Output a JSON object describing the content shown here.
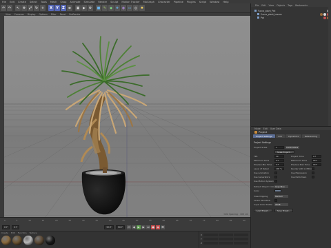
{
  "menubar": [
    "File",
    "Edit",
    "Create",
    "Select",
    "Tools",
    "Mesh",
    "Snap",
    "Animate",
    "Simulate",
    "Render",
    "Sculpt",
    "Motion Tracker",
    "MoGraph",
    "Character",
    "Pipeline",
    "Plugins",
    "Script",
    "Window",
    "Help"
  ],
  "toolbar": {
    "x": "X",
    "y": "Y",
    "z": "Z"
  },
  "viewport": {
    "menu": [
      "View",
      "Cameras",
      "Display",
      "Options",
      "Filter",
      "Panel",
      "ProRender"
    ],
    "grid_spacing": "Grid Spacing : 100 cm"
  },
  "timeline": {
    "ticks": [
      "0",
      "5",
      "10",
      "15",
      "20",
      "25",
      "30",
      "35",
      "40",
      "45",
      "50",
      "55",
      "60",
      "65",
      "70",
      "75",
      "80",
      "85",
      "90"
    ],
    "current_frame": "0 F",
    "start_frame": "0 F",
    "end_frame": "90 F",
    "end_frame_right": "90 F"
  },
  "materials": {
    "menu": [
      "Create",
      "Edit",
      "Function",
      "Texture"
    ],
    "swatch_colors": [
      "#8a6a3e",
      "#6b5433",
      "#b9b9b9",
      "#5c4a36",
      "#1a1a1a"
    ]
  },
  "coordinates": {
    "labels": [
      "X",
      "Y",
      "Z"
    ]
  },
  "object_manager": {
    "menu": [
      "File",
      "Edit",
      "View",
      "Objects",
      "Tags",
      "Bookmarks"
    ],
    "objects": [
      {
        "name": "Yucca_plant_Pot",
        "indent": 0,
        "tags": [
          "#8c8c8c"
        ]
      },
      {
        "name": "Yucca_plant_leaves",
        "indent": 1,
        "tags": [
          "#9a6a3a",
          "#d9d9d9",
          "#c05050"
        ]
      },
      {
        "name": "Pot",
        "indent": 1,
        "tags": [
          "#c05050",
          "#9a6a3a"
        ]
      }
    ]
  },
  "attributes": {
    "menu": [
      "Mode",
      "Edit",
      "User Data"
    ],
    "title": "Project",
    "tabs": [
      {
        "label": "Project Settings",
        "active": true
      },
      {
        "label": "Info",
        "active": false
      },
      {
        "label": "Dynamics",
        "active": false
      },
      {
        "label": "Referencing",
        "active": false
      }
    ],
    "section": "Project Settings",
    "project_scale_label": "Project Scale",
    "project_scale_value": "1",
    "project_scale_unit": "Centimeters",
    "scale_button": "Scale Project...",
    "rows": [
      {
        "l1": "FPS",
        "v1": "30",
        "l2": "Project Time",
        "v2": "0 F"
      },
      {
        "l1": "Minimum Time",
        "v1": "0 F",
        "l2": "Maximum Time",
        "v2": "90 F"
      },
      {
        "l1": "Preview Min Time",
        "v1": "0 F",
        "l2": "Preview Max Time",
        "v2": "90 F"
      },
      {
        "l1": "Level of Detail",
        "v1": "100 %",
        "l2": "Render LOD in Editor",
        "v2": ""
      },
      {
        "l1": "Use Animation",
        "v1": "",
        "l2": "Use Expression",
        "v2": ""
      },
      {
        "l1": "Use Generators",
        "v1": "",
        "l2": "Use Deformers",
        "v2": ""
      },
      {
        "l1": "Use Motion System",
        "v1": "",
        "l2": "",
        "v2": ""
      }
    ],
    "default_color_label": "Default Object Color",
    "default_color_value": "Gray Blue",
    "color_label": "Color",
    "view_clipping_label": "View Clipping",
    "view_clipping_value": "Medium",
    "linear_workflow_label": "Linear Workflow",
    "input_color_label": "Input Color Profile",
    "input_color_value": "sRGB",
    "load_preset": "Load Preset...",
    "save_preset": "Save Preset..."
  }
}
